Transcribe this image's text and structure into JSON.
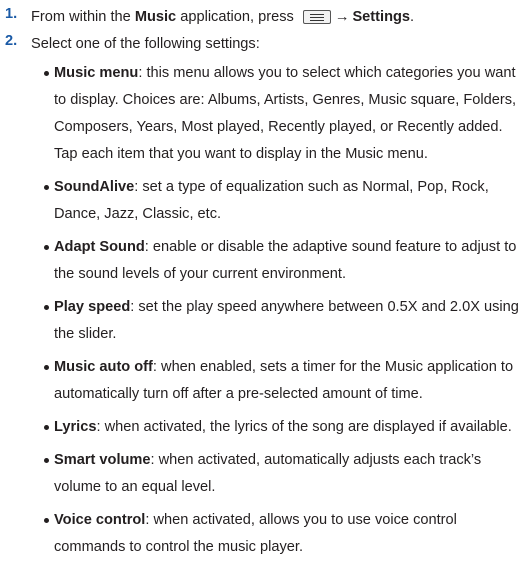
{
  "steps": [
    {
      "number": "1.",
      "prefix": "From within the ",
      "app": "Music",
      "middle": " application, press ",
      "menu_icon": "menu-key-icon",
      "arrow": "→",
      "target": "Settings",
      "suffix": "."
    },
    {
      "number": "2.",
      "text": "Select one of the following settings:"
    }
  ],
  "settings": [
    {
      "label": "Music menu",
      "description": ": this menu allows you to select which categories you want to display. Choices are: Albums, Artists, Genres, Music square, Folders, Composers, Years, Most played, Recently played, or Recently added. Tap each item that you want to display in the Music menu."
    },
    {
      "label": "SoundAlive",
      "description": ": set a type of equalization such as Normal, Pop, Rock, Dance, Jazz, Classic, etc."
    },
    {
      "label": "Adapt Sound",
      "description": ": enable or disable the adaptive sound feature to adjust to the sound levels of your current environment."
    },
    {
      "label": "Play speed",
      "description": ": set the play speed anywhere between 0.5X and 2.0X using the slider."
    },
    {
      "label": "Music auto off",
      "description": ": when enabled, sets a timer for the Music application to automatically turn off after a pre-selected amount of time."
    },
    {
      "label": "Lyrics",
      "description": ": when activated, the lyrics of the song are displayed if available."
    },
    {
      "label": "Smart volume",
      "description": ": when activated, automatically adjusts each track’s volume to an equal level."
    },
    {
      "label": "Voice control",
      "description": ": when activated, allows you to use voice control commands to control the music player."
    }
  ],
  "colors": {
    "step_number": "#1a5aa6",
    "text": "#231f20"
  }
}
